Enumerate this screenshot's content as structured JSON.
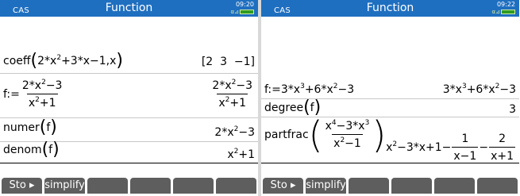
{
  "screens": [
    {
      "mode": "CAS",
      "title": "Function",
      "time": "09:20",
      "status_flag": "ᵃ",
      "entries": [
        {
          "input": "coeff(2*x²+3*x−1,x)",
          "output": "[2 3 −1]"
        },
        {
          "input": "f:=(2*x²−3)/(x²+1)",
          "output": "(2*x²−3)/(x²+1)"
        },
        {
          "input": "numer(f)",
          "output": "2*x²−3"
        },
        {
          "input": "denom(f)",
          "output": "x²+1"
        }
      ],
      "softkeys": [
        "Sto ▸",
        "simplify",
        "",
        "",
        "",
        ""
      ]
    },
    {
      "mode": "CAS",
      "title": "Function",
      "time": "09:22",
      "status_flag": "ᵃ",
      "entries": [
        {
          "input": "f:=3*x³+6*x²−3",
          "output": "3*x³+6*x²−3"
        },
        {
          "input": "degree(f)",
          "output": "3"
        },
        {
          "input": "partfrac((x⁴−3*x³)/(x²−1))",
          "output": "x²−3*x+1−1/(x−1)−2/(x+1)"
        }
      ],
      "softkeys": [
        "Sto ▸",
        "simplify",
        "",
        "",
        "",
        ""
      ]
    }
  ],
  "colors": {
    "titlebar": "#1f6fc0",
    "softkey": "#5e5e5e",
    "battery": "#2f9b22"
  }
}
